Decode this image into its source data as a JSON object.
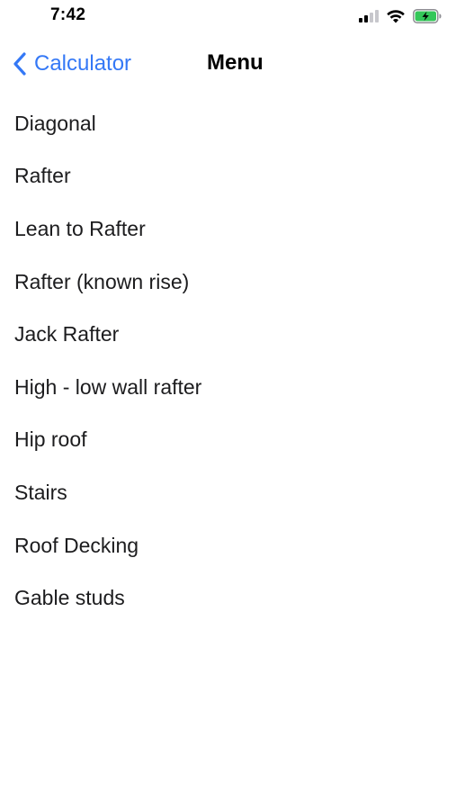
{
  "status_bar": {
    "time": "7:42",
    "icons": [
      "cellular-signal-icon",
      "wifi-icon",
      "battery-charging-icon"
    ],
    "battery_color": "#34c759"
  },
  "nav": {
    "back_label": "Calculator",
    "title": "Menu",
    "accent_color": "#3478f6"
  },
  "menu": {
    "items": [
      {
        "label": "Diagonal"
      },
      {
        "label": "Rafter"
      },
      {
        "label": "Lean to Rafter"
      },
      {
        "label": "Rafter (known rise)"
      },
      {
        "label": "Jack Rafter"
      },
      {
        "label": "High - low wall rafter"
      },
      {
        "label": "Hip roof"
      },
      {
        "label": "Stairs"
      },
      {
        "label": "Roof Decking"
      },
      {
        "label": "Gable studs"
      }
    ]
  }
}
